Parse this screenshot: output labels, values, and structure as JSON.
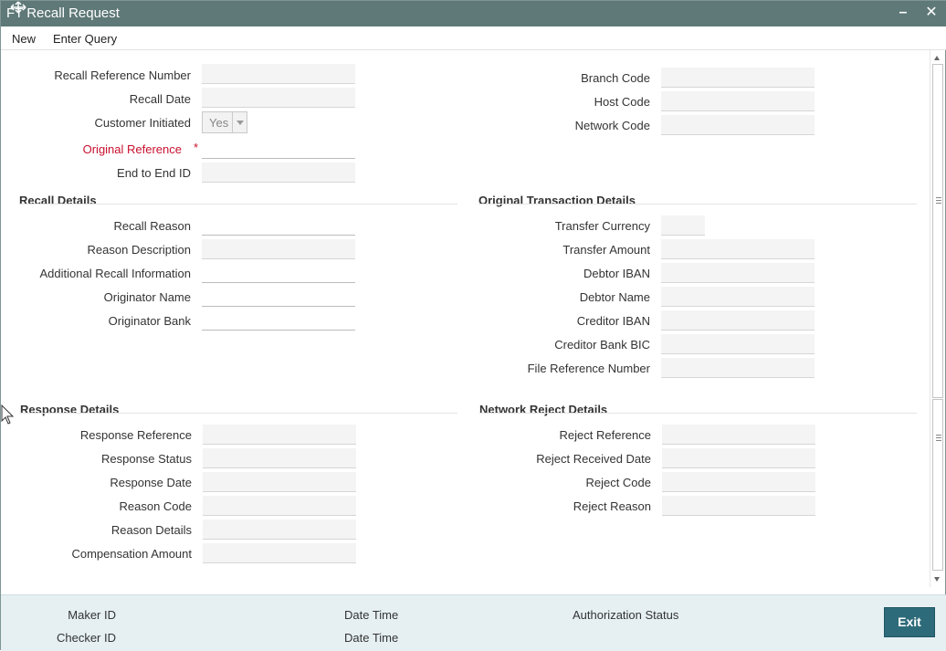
{
  "window": {
    "title": "FT Recall Request",
    "minimize_symbol": "–",
    "close_symbol": "✕"
  },
  "menu": {
    "new_label": "New",
    "enter_query_label": "Enter Query"
  },
  "header_fields": {
    "recall_reference_number": {
      "label": "Recall Reference Number",
      "value": ""
    },
    "recall_date": {
      "label": "Recall Date",
      "value": ""
    },
    "customer_initiated": {
      "label": "Customer Initiated",
      "value": "Yes"
    },
    "original_reference": {
      "label": "Original Reference",
      "required_mark": "*",
      "value": ""
    },
    "end_to_end_id": {
      "label": "End to End ID",
      "value": ""
    },
    "branch_code": {
      "label": "Branch Code",
      "value": ""
    },
    "host_code": {
      "label": "Host Code",
      "value": ""
    },
    "network_code": {
      "label": "Network Code",
      "value": ""
    }
  },
  "recall_details": {
    "title": "Recall Details",
    "recall_reason": {
      "label": "Recall Reason",
      "value": ""
    },
    "reason_description": {
      "label": "Reason Description",
      "value": ""
    },
    "additional_recall_information": {
      "label": "Additional Recall Information",
      "value": ""
    },
    "originator_name": {
      "label": "Originator Name",
      "value": ""
    },
    "originator_bank": {
      "label": "Originator Bank",
      "value": ""
    }
  },
  "original_transaction_details": {
    "title": "Original Transaction Details",
    "transfer_currency": {
      "label": "Transfer Currency",
      "value": ""
    },
    "transfer_amount": {
      "label": "Transfer Amount",
      "value": ""
    },
    "debtor_iban": {
      "label": "Debtor IBAN",
      "value": ""
    },
    "debtor_name": {
      "label": "Debtor Name",
      "value": ""
    },
    "creditor_iban": {
      "label": "Creditor IBAN",
      "value": ""
    },
    "creditor_bank_bic": {
      "label": "Creditor Bank BIC",
      "value": ""
    },
    "file_reference_number": {
      "label": "File Reference Number",
      "value": ""
    }
  },
  "response_details": {
    "title": "Response Details",
    "response_reference": {
      "label": "Response Reference",
      "value": ""
    },
    "response_status": {
      "label": "Response Status",
      "value": ""
    },
    "response_date": {
      "label": "Response Date",
      "value": ""
    },
    "reason_code": {
      "label": "Reason Code",
      "value": ""
    },
    "reason_details": {
      "label": "Reason Details",
      "value": ""
    },
    "compensation_amount": {
      "label": "Compensation Amount",
      "value": ""
    }
  },
  "network_reject_details": {
    "title": "Network Reject Details",
    "reject_reference": {
      "label": "Reject Reference",
      "value": ""
    },
    "reject_received_date": {
      "label": "Reject Received Date",
      "value": ""
    },
    "reject_code": {
      "label": "Reject Code",
      "value": ""
    },
    "reject_reason": {
      "label": "Reject Reason",
      "value": ""
    }
  },
  "footer": {
    "maker_id_label": "Maker ID",
    "checker_id_label": "Checker ID",
    "date_time_label_1": "Date Time",
    "date_time_label_2": "Date Time",
    "authorization_status_label": "Authorization Status",
    "exit_label": "Exit"
  },
  "colors": {
    "title_bar": "#5f7978",
    "required": "#c8102e",
    "footer_bg": "#e6f0f3",
    "exit_button": "#2e6b7a"
  }
}
